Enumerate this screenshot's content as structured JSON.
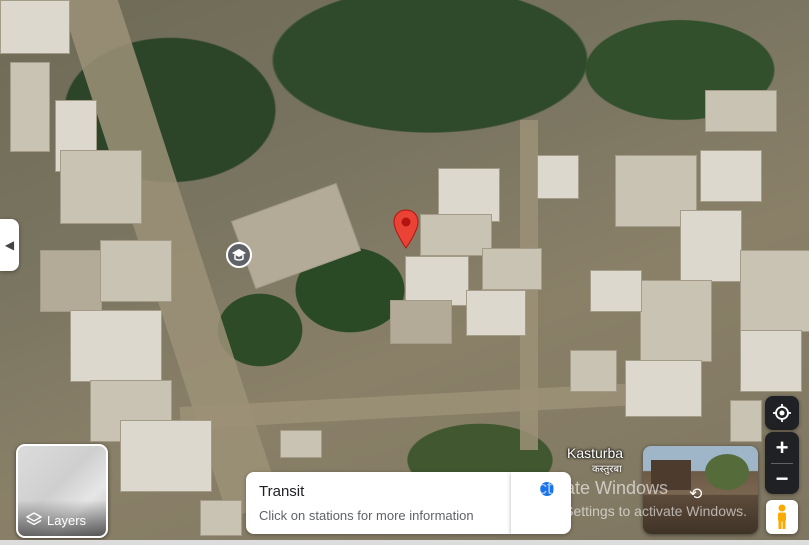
{
  "map": {
    "view": "satellite"
  },
  "sidebar_toggle": {
    "icon": "chevron-left-icon",
    "glyph": "◀"
  },
  "layers": {
    "label": "Layers",
    "icon": "layers-icon"
  },
  "transit": {
    "title": "Transit",
    "subtitle": "Click on stations for more information"
  },
  "place": {
    "name": "Kasturba",
    "local_name": "कस्तुरबा"
  },
  "watermark": {
    "line1": "Activate Windows",
    "line2": "Go to Settings to activate Windows."
  },
  "controls": {
    "my_location_icon": "my-location-icon",
    "zoom_in": "+",
    "zoom_out": "−",
    "pegman_icon": "pegman-icon"
  },
  "colors": {
    "pin": "#ea4335",
    "accent": "#1a73e8",
    "control_bg": "#202124",
    "pegman": "#f9ab00"
  }
}
